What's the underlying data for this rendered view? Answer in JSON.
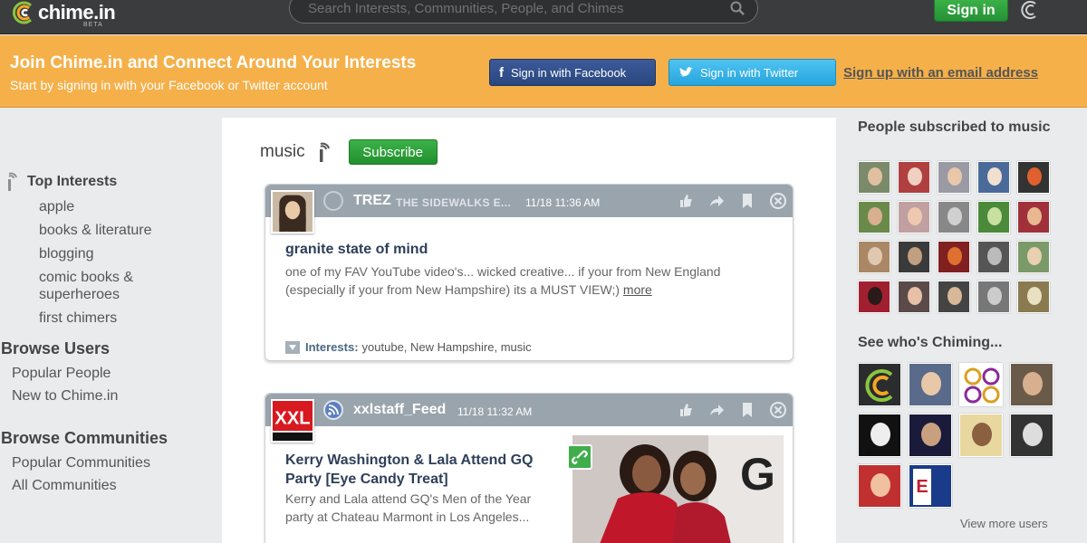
{
  "header": {
    "logo_text": "chime.in",
    "logo_beta": "BETA",
    "search_placeholder": "Search Interests, Communities, People, and Chimes",
    "signin_label": "Sign in"
  },
  "banner": {
    "title": "Join Chime.in and Connect Around Your Interests",
    "subtitle": "Start by signing in with your Facebook or Twitter account",
    "facebook_label": "Sign in with Facebook",
    "twitter_label": "Sign in with Twitter",
    "email_link": "Sign up with an email address",
    "color": "#f5b04a"
  },
  "sidebar": {
    "top_interests_label": "Top Interests",
    "interests": [
      "apple",
      "books & literature",
      "blogging",
      "comic books & superheroes",
      "first chimers"
    ],
    "browse_users_label": "Browse Users",
    "browse_users": [
      "Popular People",
      "New to Chime.in"
    ],
    "browse_communities_label": "Browse Communities",
    "browse_communities": [
      "Popular Communities",
      "All Communities"
    ]
  },
  "interest": {
    "name": "music",
    "subscribe_label": "Subscribe"
  },
  "posts": [
    {
      "user": "TREZ",
      "community": "THE SIDEWALKS E...",
      "time": "11/18 11:36 AM",
      "title": "granite state of mind",
      "body": "one of my FAV YouTube video's... wicked creative... if your from New England (especially if your from New Hampshire) its a MUST VIEW;)",
      "more_label": "more",
      "interests_label": "Interests:",
      "interests": "youtube, New Hampshire, music"
    },
    {
      "user": "xxlstaff_Feed",
      "time": "11/18 11:32 AM",
      "logo_text": "XXL",
      "title": "Kerry Washington & Lala Attend GQ Party [Eye Candy Treat]",
      "body": "Kerry and Lala attend GQ's Men of the Year party at Chateau Marmont in Los Angeles..."
    }
  ],
  "right": {
    "subscribed_title": "People subscribed to music",
    "chiming_title": "See who's Chiming...",
    "view_more_label": "View more users"
  },
  "colors": {
    "topbar": "#3a3c3e",
    "green": "#2e9e3c",
    "card_header": "#9aa4ad",
    "title_blue": "#2e3f5a"
  }
}
